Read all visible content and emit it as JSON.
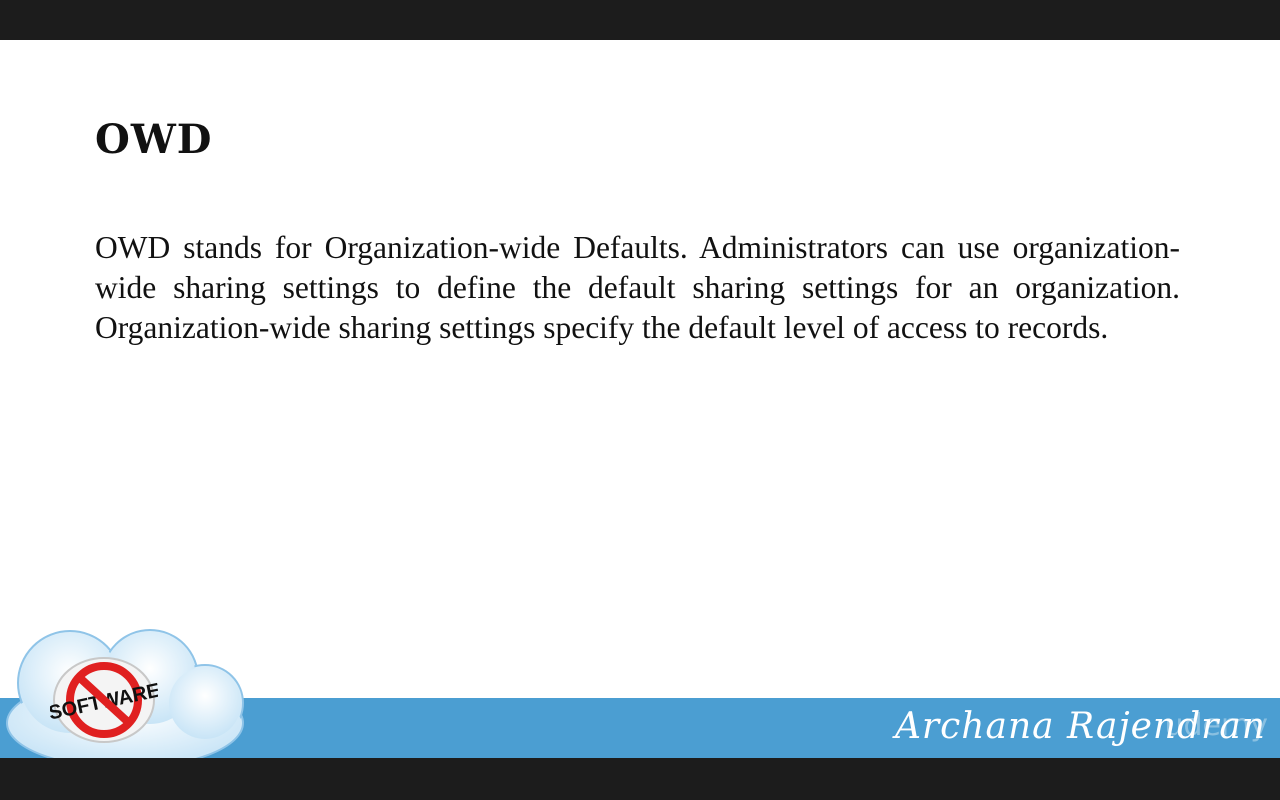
{
  "slide": {
    "title": "OWD",
    "body": "OWD stands for Organization-wide Defaults. Administrators can use organization-wide sharing settings to define the default sharing settings for an organization. Organization-wide sharing settings specify the default level of access to records."
  },
  "footer": {
    "logo_text": "SOFTWARE",
    "signature": "Archana Rajendran",
    "watermark": "udemy"
  },
  "colors": {
    "letterbox": "#1c1c1c",
    "footer_band": "#4b9ed2",
    "cloud": "#cfe6f6",
    "no_symbol": "#e02020"
  }
}
